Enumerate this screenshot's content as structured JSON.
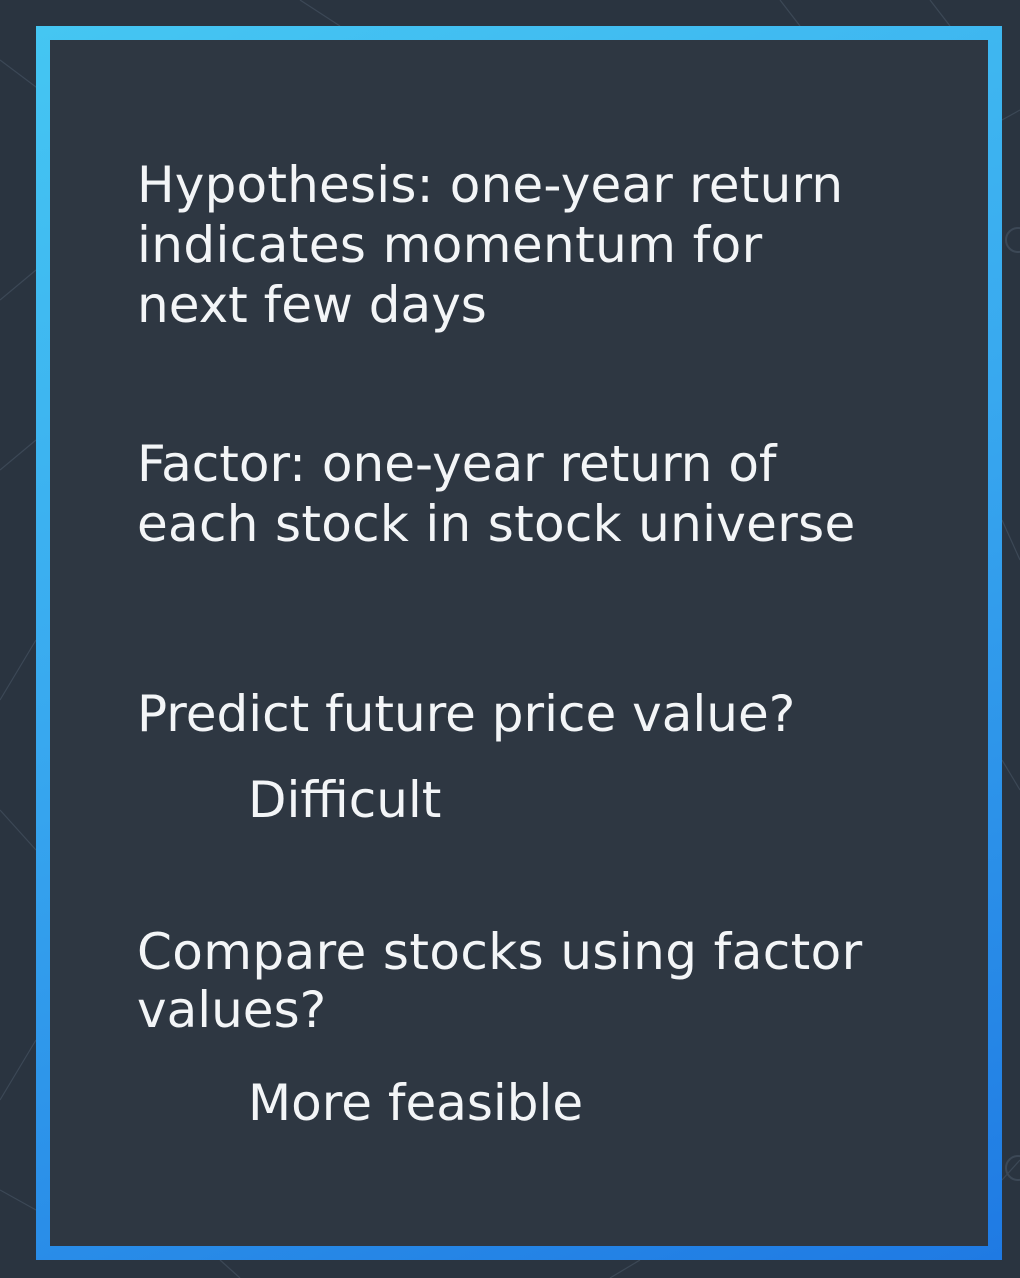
{
  "slide": {
    "hypothesis_line1": "Hypothesis: one-year return",
    "hypothesis_line2": "indicates momentum for",
    "hypothesis_line3": "next few days",
    "factor_line1": "Factor: one-year return of",
    "factor_line2": "each stock in stock universe",
    "predict_question": "Predict future price value?",
    "predict_answer": "Difficult",
    "compare_line1": "Compare stocks using factor",
    "compare_line2": "values?",
    "compare_answer": "More feasible"
  },
  "colors": {
    "background": "#2a3440",
    "panel": "#2e3742",
    "border_top": "#45c6f2",
    "border_bottom": "#1f7ae3",
    "text": "#f3f5f7"
  }
}
